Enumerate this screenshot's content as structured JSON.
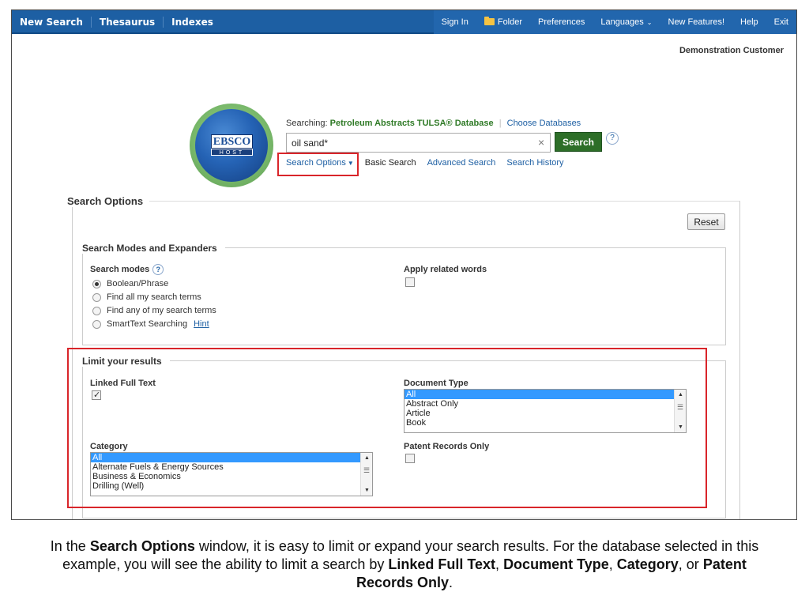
{
  "nav": {
    "left": [
      "New Search",
      "Thesaurus",
      "Indexes"
    ],
    "right": {
      "sign_in": "Sign In",
      "folder": "Folder",
      "preferences": "Preferences",
      "languages": "Languages",
      "new_features": "New Features!",
      "help": "Help",
      "exit": "Exit"
    }
  },
  "customer": "Demonstration Customer",
  "logo": {
    "brand": "EBSCO",
    "sub": "HOST"
  },
  "search": {
    "searching_label": "Searching:",
    "database": "Petroleum Abstracts TULSA® Database",
    "choose": "Choose Databases",
    "query": "oil sand*",
    "button": "Search",
    "help": "?",
    "links": {
      "options": "Search Options",
      "basic": "Basic Search",
      "advanced": "Advanced Search",
      "history": "Search History"
    }
  },
  "options": {
    "title": "Search Options",
    "reset": "Reset",
    "modes_section": "Search Modes and Expanders",
    "modes_label": "Search modes",
    "modes": [
      "Boolean/Phrase",
      "Find all my search terms",
      "Find any of my search terms",
      "SmartText Searching"
    ],
    "selected_mode": "Boolean/Phrase",
    "hint": "Hint",
    "related_words": "Apply related words",
    "related_words_checked": false,
    "limit_section": "Limit your results",
    "linked_full_text": "Linked Full Text",
    "linked_full_text_checked": true,
    "document_type": "Document Type",
    "document_type_options": [
      "All",
      "Abstract Only",
      "Article",
      "Book"
    ],
    "category": "Category",
    "category_options": [
      "All",
      "Alternate Fuels & Energy Sources",
      "Business & Economics",
      "Drilling (Well)"
    ],
    "patent_only": "Patent Records Only",
    "patent_only_checked": false
  },
  "caption": {
    "t1": "In the ",
    "b1": "Search Options",
    "t2": " window, it is easy to limit or expand your search results. For the database selected in this example, you will see the ability to limit a search by ",
    "b2": "Linked Full Text",
    "t3": ", ",
    "b3": "Document Type",
    "t4": ", ",
    "b4": "Category",
    "t5": ", or ",
    "b5": "Patent Records Only",
    "t6": "."
  },
  "colors": {
    "nav_blue": "#1d5fa3",
    "search_green": "#2d6e28",
    "highlight_red": "#d9252a",
    "link_blue": "#1d5fa3"
  }
}
